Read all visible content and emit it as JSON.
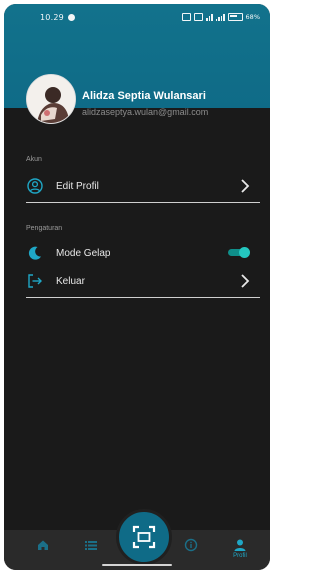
{
  "status_bar": {
    "time": "10.29",
    "battery": "68%"
  },
  "profile": {
    "name": "Alidza Septia Wulansari",
    "email": "alidzaseptya.wulan@gmail.com"
  },
  "sections": {
    "account": {
      "label": "Akun",
      "items": [
        {
          "label": "Edit Profil",
          "icon": "user-circle-icon"
        }
      ]
    },
    "settings": {
      "label": "Pengaturan",
      "items": [
        {
          "label": "Mode Gelap",
          "icon": "moon-icon",
          "toggle_on": true
        },
        {
          "label": "Keluar",
          "icon": "logout-icon"
        }
      ]
    }
  },
  "bottom_nav": {
    "items": [
      {
        "icon": "home-icon"
      },
      {
        "icon": "list-icon"
      },
      {
        "icon": "info-icon"
      },
      {
        "icon": "profile-icon",
        "label": "Profil",
        "active": true
      }
    ],
    "fab_icon": "scan-icon"
  },
  "colors": {
    "header": "#0f6b87",
    "background": "#1a1a1a",
    "accent": "#1fa7c6",
    "toggle": "#24c7c0",
    "nav_bg": "#2a2a2a"
  }
}
